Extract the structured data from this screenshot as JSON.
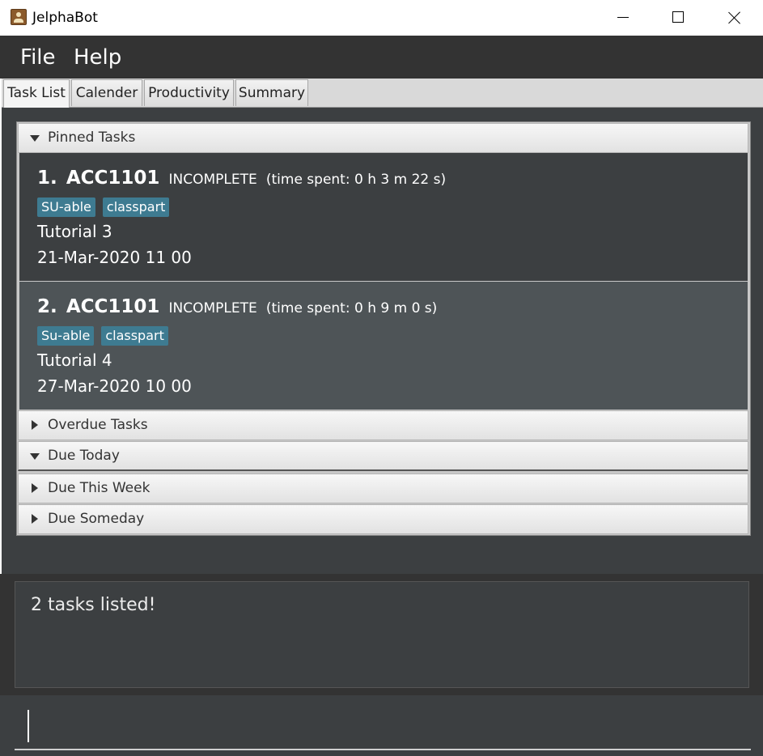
{
  "window": {
    "title": "JelphaBot",
    "icon": "contact-book-icon"
  },
  "menu": [
    {
      "label": "File"
    },
    {
      "label": "Help"
    }
  ],
  "tabs": [
    {
      "label": "Task List",
      "active": true
    },
    {
      "label": "Calender",
      "active": false
    },
    {
      "label": "Productivity",
      "active": false
    },
    {
      "label": "Summary",
      "active": false
    }
  ],
  "sections": {
    "pinned": {
      "label": "Pinned Tasks",
      "expanded": true
    },
    "overdue": {
      "label": "Overdue Tasks",
      "expanded": false
    },
    "due_today": {
      "label": "Due Today",
      "expanded": true
    },
    "due_week": {
      "label": "Due This Week",
      "expanded": false
    },
    "due_someday": {
      "label": "Due Someday",
      "expanded": false
    }
  },
  "tasks": [
    {
      "index": "1.",
      "code": "ACC1101",
      "status": "INCOMPLETE",
      "time_spent": "(time spent: 0 h 3 m 22 s)",
      "tags": [
        "SU-able",
        "classpart"
      ],
      "description": "Tutorial 3",
      "due": "21-Mar-2020 11 00"
    },
    {
      "index": "2.",
      "code": "ACC1101",
      "status": "INCOMPLETE",
      "time_spent": "(time spent: 0 h 9 m 0 s)",
      "tags": [
        "Su-able",
        "classpart"
      ],
      "description": "Tutorial 4",
      "due": "27-Mar-2020 10 00"
    }
  ],
  "result": {
    "message": "2 tasks listed!"
  },
  "command": {
    "value": ""
  },
  "colors": {
    "tag": "#3e7b91",
    "card_dark": "#3c3f41",
    "card_selected": "#4e5457",
    "menubar": "#333333"
  }
}
